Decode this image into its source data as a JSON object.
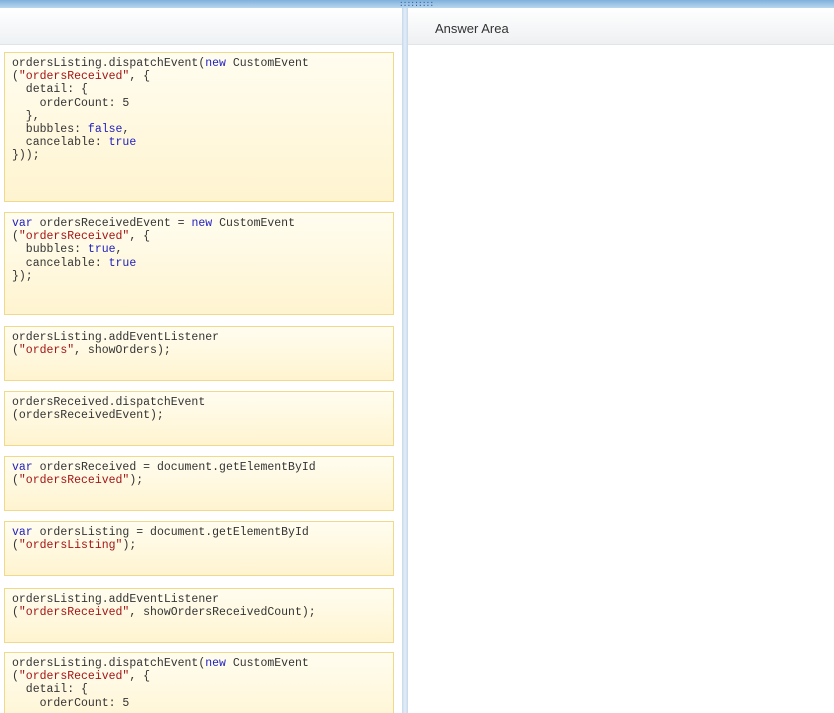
{
  "colors": {
    "keyword": "#2020c0",
    "string": "#a31515",
    "plain": "#333333",
    "snippet_border": "#f0d98a",
    "snippet_fill": "#fff8dc"
  },
  "answer_area": {
    "title": "Answer Area"
  },
  "snippets": [
    {
      "lines": [
        [
          {
            "t": "ordersListing.dispatchEvent("
          },
          {
            "t": "new",
            "k": "kw"
          },
          {
            "t": " CustomEvent"
          }
        ],
        [
          {
            "t": "("
          },
          {
            "t": "\"ordersReceived\"",
            "k": "str"
          },
          {
            "t": ", {"
          }
        ],
        [
          {
            "t": "  detail: {"
          }
        ],
        [
          {
            "t": "    orderCount: 5"
          }
        ],
        [
          {
            "t": "  },"
          }
        ],
        [
          {
            "t": "  bubbles: "
          },
          {
            "t": "false",
            "k": "kw"
          },
          {
            "t": ","
          }
        ],
        [
          {
            "t": "  cancelable: "
          },
          {
            "t": "true",
            "k": "kw"
          }
        ],
        [
          {
            "t": "}));"
          }
        ]
      ]
    },
    {
      "lines": [
        [
          {
            "t": "var",
            "k": "kw"
          },
          {
            "t": " ordersReceivedEvent = "
          },
          {
            "t": "new",
            "k": "kw"
          },
          {
            "t": " CustomEvent"
          }
        ],
        [
          {
            "t": "("
          },
          {
            "t": "\"ordersReceived\"",
            "k": "str"
          },
          {
            "t": ", {"
          }
        ],
        [
          {
            "t": "  bubbles: "
          },
          {
            "t": "true",
            "k": "kw"
          },
          {
            "t": ","
          }
        ],
        [
          {
            "t": "  cancelable: "
          },
          {
            "t": "true",
            "k": "kw"
          }
        ],
        [
          {
            "t": "});"
          }
        ]
      ]
    },
    {
      "lines": [
        [
          {
            "t": "ordersListing.addEventListener"
          }
        ],
        [
          {
            "t": "("
          },
          {
            "t": "\"orders\"",
            "k": "str"
          },
          {
            "t": ", showOrders);"
          }
        ]
      ]
    },
    {
      "lines": [
        [
          {
            "t": "ordersReceived.dispatchEvent"
          }
        ],
        [
          {
            "t": "(ordersReceivedEvent);"
          }
        ]
      ]
    },
    {
      "lines": [
        [
          {
            "t": "var",
            "k": "kw"
          },
          {
            "t": " ordersReceived = document.getElementById"
          }
        ],
        [
          {
            "t": "("
          },
          {
            "t": "\"ordersReceived\"",
            "k": "str"
          },
          {
            "t": ");"
          }
        ]
      ]
    },
    {
      "lines": [
        [
          {
            "t": "var",
            "k": "kw"
          },
          {
            "t": " ordersListing = document.getElementById"
          }
        ],
        [
          {
            "t": "("
          },
          {
            "t": "\"ordersListing\"",
            "k": "str"
          },
          {
            "t": ");"
          }
        ]
      ]
    },
    {
      "lines": [
        [
          {
            "t": "ordersListing.addEventListener"
          }
        ],
        [
          {
            "t": "("
          },
          {
            "t": "\"ordersReceived\"",
            "k": "str"
          },
          {
            "t": ", showOrdersReceivedCount);"
          }
        ]
      ]
    },
    {
      "lines": [
        [
          {
            "t": "ordersListing.dispatchEvent("
          },
          {
            "t": "new",
            "k": "kw"
          },
          {
            "t": " CustomEvent"
          }
        ],
        [
          {
            "t": "("
          },
          {
            "t": "\"ordersReceived\"",
            "k": "str"
          },
          {
            "t": ", {"
          }
        ],
        [
          {
            "t": "  detail: {"
          }
        ],
        [
          {
            "t": "    orderCount: 5"
          }
        ]
      ]
    }
  ]
}
